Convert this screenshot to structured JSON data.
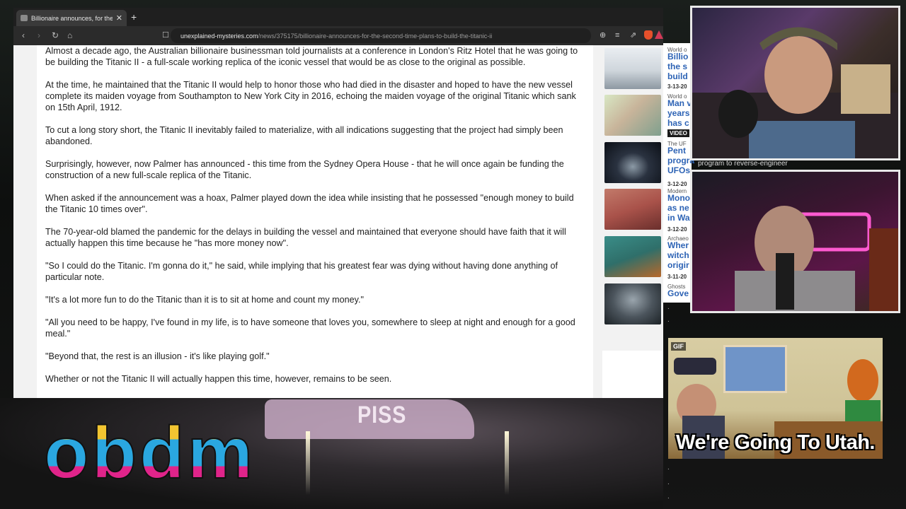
{
  "browser": {
    "tab_title": "Billionaire announces, for the se...",
    "tab_close": "✕",
    "new_tab": "+",
    "url_domain": "unexplained-mysteries.com",
    "url_path": "/news/375175/billionaire-announces-for-the-second-time-plans-to-build-the-titanic-ii"
  },
  "article": {
    "paragraphs": [
      "Almost a decade ago, the Australian billionaire businessman told journalists at a conference in London's Ritz Hotel that he was going to be building the Titanic II - a full-scale working replica of the iconic vessel that would be as close to the original as possible.",
      "At the time, he maintained that the Titanic II would help to honor those who had died in the disaster and hoped to have the new vessel complete its maiden voyage from Southampton to New York City in 2016, echoing the maiden voyage of the original Titanic which sank on 15th April, 1912.",
      "To cut a long story short, the Titanic II inevitably failed to materialize, with all indications suggesting that the project had simply been abandoned.",
      "Surprisingly, however, now Palmer has announced - this time from the Sydney Opera House - that he will once again be funding the construction of a new full-scale replica of the Titanic.",
      "When asked if the announcement was a hoax, Palmer played down the idea while insisting that he possessed \"enough money to build the Titanic 10 times over\".",
      "The 70-year-old blamed the pandemic for the delays in building the vessel and maintained that everyone should have faith that it will actually happen this time because he \"has more money now\".",
      "\"So I could do the Titanic. I'm gonna do it,\" he said, while implying that his greatest fear was dying without having done anything of particular note.",
      "\"It's a lot more fun to do the Titanic than it is to sit at home and count my money.\"",
      "\"All you need to be happy, I've found in my life, is to have someone that loves you, somewhere to sleep at night and enough for a good meal.\"",
      "\"Beyond that, the rest is an illusion - it's like playing golf.\"",
      "Whether or not the Titanic II will actually happen this time, however, remains to be seen."
    ]
  },
  "sidebar": {
    "items": [
      {
        "category": "World o",
        "title1": "Billio",
        "title2": "the s",
        "title3": "build",
        "date": "3-13-20",
        "video": ""
      },
      {
        "category": "World o",
        "title1": "Man v",
        "title2": "years",
        "title3": "has c",
        "date": "",
        "video": "VIDEO"
      },
      {
        "category": "The UF",
        "title1": "Pent",
        "title2": "progra",
        "title3": "UFOs",
        "date": "3-12-20",
        "video": ""
      },
      {
        "category": "Modern",
        "title1": "Mono",
        "title2": "as ne",
        "title3": "in Wa",
        "date": "3-12-20",
        "video": ""
      },
      {
        "category": "Archaeo",
        "title1": "Wher",
        "title2": "witch",
        "title3": "origir",
        "date": "3-11-20",
        "video": ""
      },
      {
        "category": "Ghosts",
        "title1": "Gove",
        "title2": "",
        "title3": "",
        "date": "",
        "video": ""
      }
    ]
  },
  "overlay": {
    "cam_lower_text": "program to reverse-engineer",
    "gif_tag": "GIF",
    "gif_caption": "We're Going To Utah.",
    "scene_word": "PISS",
    "logo_text": "obdm"
  },
  "colors": {
    "logo_yellow": "#f2c531",
    "logo_cyan": "#2aa7e0",
    "logo_magenta": "#e0248a",
    "link_blue": "#2d63b5"
  }
}
